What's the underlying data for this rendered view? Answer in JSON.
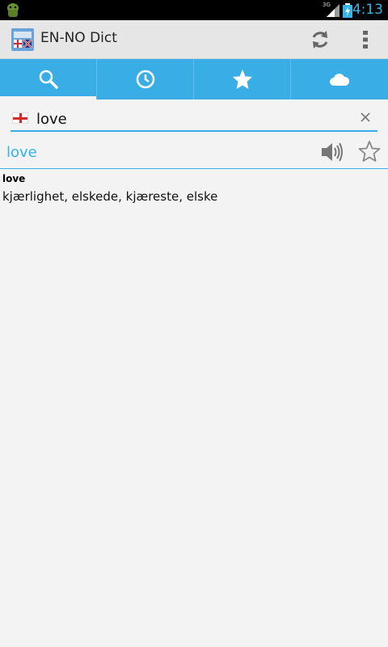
{
  "status_bar": {
    "network": "3G",
    "time": "4:13"
  },
  "action_bar": {
    "title": "EN-NO Dict",
    "actions": [
      "refresh-icon",
      "overflow-menu-icon"
    ]
  },
  "tabs": [
    {
      "icon": "search-icon",
      "active": true
    },
    {
      "icon": "history-clock-icon",
      "active": false
    },
    {
      "icon": "favorites-star-icon",
      "active": false
    },
    {
      "icon": "cloud-icon",
      "active": false
    }
  ],
  "search": {
    "value": "love",
    "language_flag": "england-flag-icon"
  },
  "result": {
    "word": "love",
    "definition_headword": "love",
    "definition": "kjærlighet, elskede, kjæreste, elske"
  },
  "colors": {
    "accent": "#33b5e5",
    "tab_bar": "#39aee6",
    "action_bar": "#e6e6e6",
    "background": "#f3f3f3"
  }
}
